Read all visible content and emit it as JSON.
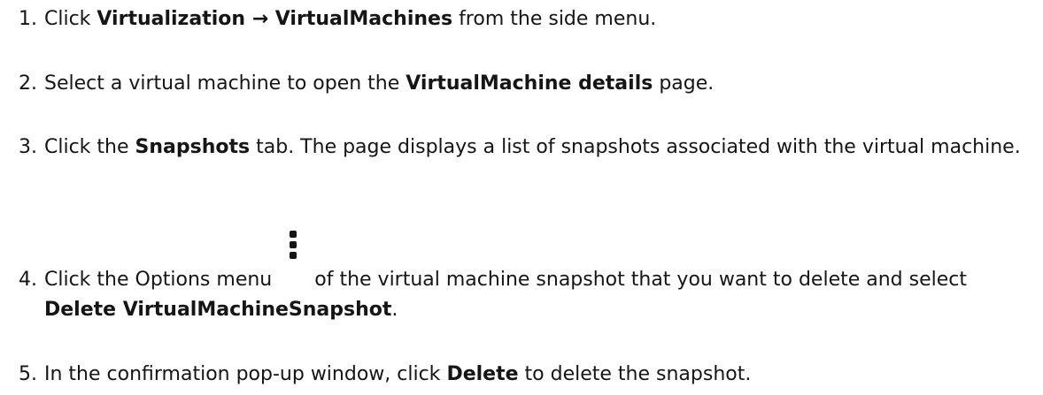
{
  "steps": [
    {
      "number": "1.",
      "click": "Click",
      "menu_path": "Virtualization → VirtualMachines",
      "tail": "from the side menu."
    },
    {
      "number": "2.",
      "lead": "Select a virtual machine to open the",
      "page_name": "VirtualMachine details",
      "tail": "page."
    },
    {
      "number": "3.",
      "lead": "Click the",
      "tab_name": "Snapshots",
      "tail": "tab. The page displays a list of snapshots associated with the virtual machine."
    },
    {
      "number": "4.",
      "lead": "Click the Options menu",
      "icon": "kebab-menu-icon",
      "middle": "of the virtual machine snapshot that you want to delete and select",
      "action": "Delete VirtualMachineSnapshot",
      "tail": "."
    },
    {
      "number": "5.",
      "lead": "In the confirmation pop-up window, click",
      "button": "Delete",
      "tail": "to delete the snapshot."
    }
  ]
}
